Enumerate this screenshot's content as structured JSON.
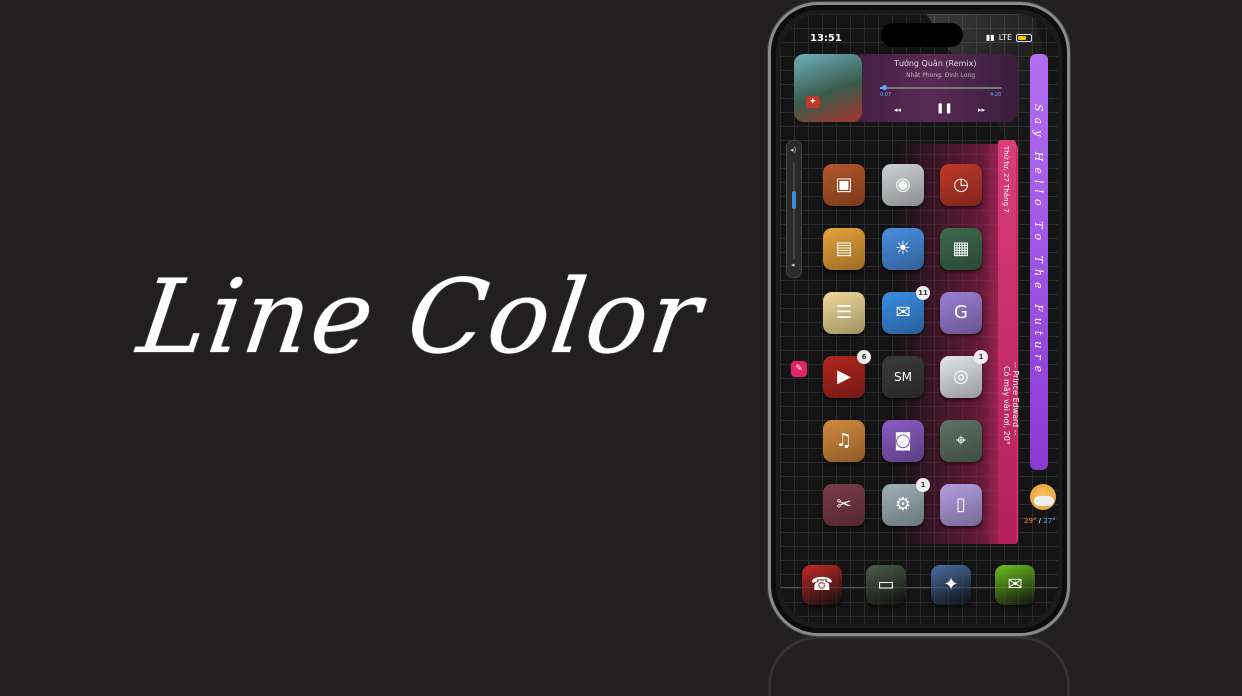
{
  "headline": "Line Color",
  "status": {
    "time": "13:51",
    "network": "LTE"
  },
  "music": {
    "title": "Tướng Quân (Remix)",
    "artist": "Nhật Phong, Đinh Long",
    "elapsed": "0:07",
    "total": "4:20",
    "progress": 0.04,
    "controls": {
      "prev": "◂◂",
      "pause": "❚❚",
      "next": "▸▸"
    }
  },
  "widgets": {
    "say_hello": "Say Hello To The Future",
    "date_text": "Thứ tư, 27 Tháng 7",
    "quote_author": "-- Prince Edward --",
    "quote_weather": "Có mây vài nơi, 20°"
  },
  "weather": {
    "high": "29°",
    "separator": "/",
    "low": "27°"
  },
  "volume": {
    "level": 0.45,
    "hi_icon": "◂)",
    "lo_icon": "◂"
  },
  "icons": [
    {
      "name": "photo-app-icon",
      "color": "#b5572a",
      "glyph": "▣",
      "badge": ""
    },
    {
      "name": "camera-app-icon",
      "color": "#cfd2d4",
      "glyph": "◉",
      "badge": ""
    },
    {
      "name": "clock-app-icon",
      "color": "#c0392b",
      "glyph": "◷",
      "badge": ""
    },
    {
      "name": "calendar-app-icon",
      "color": "#e8a23a",
      "glyph": "▤",
      "badge": ""
    },
    {
      "name": "weather-app-icon",
      "color": "#4a90e2",
      "glyph": "☀",
      "badge": ""
    },
    {
      "name": "calculator-app-icon",
      "color": "#3d6b4f",
      "glyph": "▦",
      "badge": ""
    },
    {
      "name": "notes-app-icon",
      "color": "#f0d998",
      "glyph": "☰",
      "badge": ""
    },
    {
      "name": "mail-app-icon",
      "color": "#3a8ee6",
      "glyph": "✉",
      "badge": "11"
    },
    {
      "name": "translate-app-icon",
      "color": "#9c7fd6",
      "glyph": "G",
      "badge": ""
    },
    {
      "name": "youtube-app-icon",
      "color": "#b0261e",
      "glyph": "▶",
      "badge": "6"
    },
    {
      "name": "sm-pro-app-icon",
      "color": "#3b3b3b",
      "glyph": "SM",
      "badge": ""
    },
    {
      "name": "lens-app-icon",
      "color": "#e3e6e8",
      "glyph": "◎",
      "badge": "1"
    },
    {
      "name": "music-app-icon",
      "color": "#d28a3c",
      "glyph": "♫",
      "badge": ""
    },
    {
      "name": "game-app-icon",
      "color": "#8a5cc4",
      "glyph": "◙",
      "badge": ""
    },
    {
      "name": "maps-app-icon",
      "color": "#5e7265",
      "glyph": "⌖",
      "badge": ""
    },
    {
      "name": "tools-app-icon",
      "color": "#7b3b4b",
      "glyph": "✂",
      "badge": ""
    },
    {
      "name": "settings-app-icon",
      "color": "#9fb1b8",
      "glyph": "⚙",
      "badge": "1"
    },
    {
      "name": "files-app-icon",
      "color": "#b39ee0",
      "glyph": "▯",
      "badge": ""
    }
  ],
  "dock": [
    {
      "name": "phone-dock-icon",
      "color": "#c62828",
      "glyph": "☎"
    },
    {
      "name": "store-dock-icon",
      "color": "#4b5e4b",
      "glyph": "▭"
    },
    {
      "name": "safari-dock-icon",
      "color": "#4a6fa5",
      "glyph": "✦"
    },
    {
      "name": "messages-dock-icon",
      "color": "#6dc21e",
      "glyph": "✉"
    }
  ]
}
